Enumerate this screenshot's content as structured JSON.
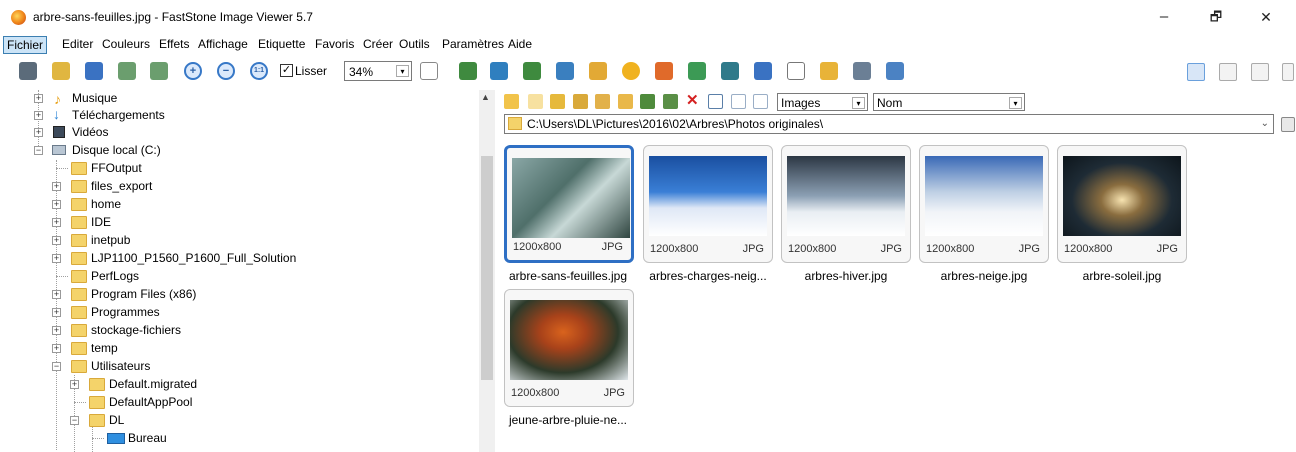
{
  "window": {
    "title": "arbre-sans-feuilles.jpg  -  FastStone Image Viewer 5.7",
    "minimize": "–",
    "maximize": "🗗",
    "close": "✕"
  },
  "menu": {
    "items": [
      "Fichier",
      "Editer",
      "Couleurs",
      "Effets",
      "Affichage",
      "Etiquette",
      "Favoris",
      "Créer",
      "Outils",
      "Paramètres",
      "Aide"
    ],
    "active": "Fichier"
  },
  "toolbar": {
    "smooth_checked": "✓",
    "smooth_label": "Lisser",
    "zoom": "34%",
    "zoom_arrow": "▾"
  },
  "tree": {
    "nodes": [
      {
        "label": "Musique",
        "icon": "music-icon"
      },
      {
        "label": "Téléchargements",
        "icon": "download-icon"
      },
      {
        "label": "Vidéos",
        "icon": "video-icon"
      },
      {
        "label": "Disque local (C:)",
        "icon": "drive-icon"
      },
      {
        "label": "FFOutput",
        "icon": "folder-icon"
      },
      {
        "label": "files_export",
        "icon": "folder-icon"
      },
      {
        "label": "home",
        "icon": "folder-icon"
      },
      {
        "label": "IDE",
        "icon": "folder-icon"
      },
      {
        "label": "inetpub",
        "icon": "folder-icon"
      },
      {
        "label": "LJP1100_P1560_P1600_Full_Solution",
        "icon": "folder-icon"
      },
      {
        "label": "PerfLogs",
        "icon": "folder-icon"
      },
      {
        "label": "Program Files (x86)",
        "icon": "folder-icon"
      },
      {
        "label": "Programmes",
        "icon": "folder-icon"
      },
      {
        "label": "stockage-fichiers",
        "icon": "folder-icon"
      },
      {
        "label": "temp",
        "icon": "folder-icon"
      },
      {
        "label": "Utilisateurs",
        "icon": "folder-icon"
      },
      {
        "label": "Default.migrated",
        "icon": "folder-icon"
      },
      {
        "label": "DefaultAppPool",
        "icon": "folder-icon"
      },
      {
        "label": "DL",
        "icon": "folder-icon"
      },
      {
        "label": "Bureau",
        "icon": "desktop-icon"
      }
    ]
  },
  "browser": {
    "view_type": "Images",
    "sort_by": "Nom",
    "path": "C:\\Users\\DL\\Pictures\\2016\\02\\Arbres\\Photos originales\\",
    "combo_arrow": "▾",
    "path_chevron": "⌄"
  },
  "thumbnails": [
    {
      "name": "arbre-sans-feuilles.jpg",
      "dims": "1200x800",
      "format": "JPG",
      "selected": true
    },
    {
      "name": "arbres-charges-neig...",
      "dims": "1200x800",
      "format": "JPG",
      "selected": false
    },
    {
      "name": "arbres-hiver.jpg",
      "dims": "1200x800",
      "format": "JPG",
      "selected": false
    },
    {
      "name": "arbres-neige.jpg",
      "dims": "1200x800",
      "format": "JPG",
      "selected": false
    },
    {
      "name": "arbre-soleil.jpg",
      "dims": "1200x800",
      "format": "JPG",
      "selected": false
    },
    {
      "name": "jeune-arbre-pluie-ne...",
      "dims": "1200x800",
      "format": "JPG",
      "selected": false
    }
  ]
}
